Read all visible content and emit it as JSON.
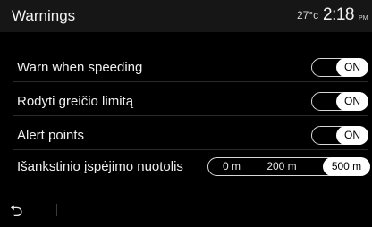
{
  "header": {
    "title": "Warnings",
    "temperature": "27°c",
    "time": "2:18",
    "time_suffix": "PM"
  },
  "settings": [
    {
      "label": "Warn when speeding",
      "state": "ON"
    },
    {
      "label": "Rodyti greičio limitą",
      "state": "ON"
    },
    {
      "label": "Alert points",
      "state": "ON"
    }
  ],
  "distance": {
    "label": "Išankstinio įspėjimo nuotolis",
    "options": [
      "0 m",
      "200 m",
      "500 m"
    ],
    "selected": "500 m"
  },
  "footer": {
    "back_icon": "back-arrow-icon",
    "back_glyph": "⮌"
  }
}
